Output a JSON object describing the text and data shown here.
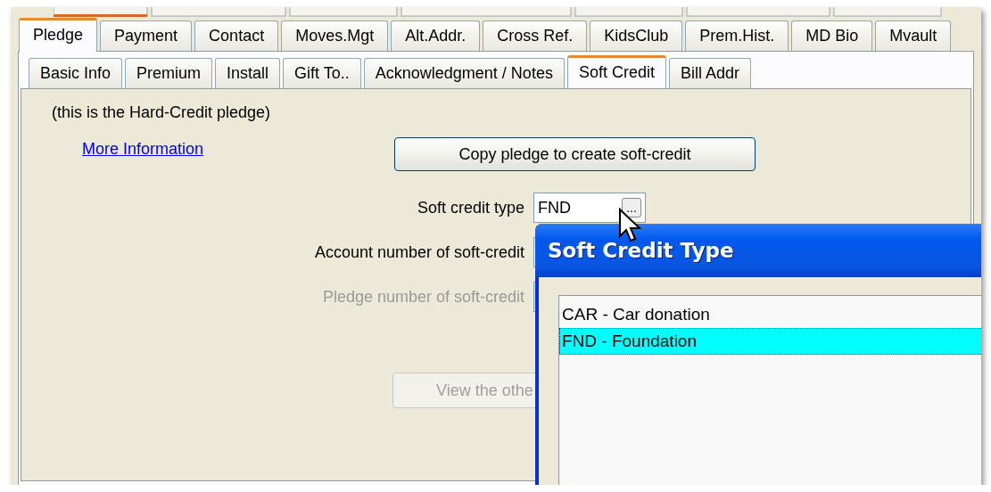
{
  "main_tabs": [
    {
      "label": "Pledge",
      "selected": true
    },
    {
      "label": "Payment",
      "selected": false
    },
    {
      "label": "Contact",
      "selected": false
    },
    {
      "label": "Moves.Mgt",
      "selected": false
    },
    {
      "label": "Alt.Addr.",
      "selected": false
    },
    {
      "label": "Cross Ref.",
      "selected": false
    },
    {
      "label": "KidsClub",
      "selected": false
    },
    {
      "label": "Prem.Hist.",
      "selected": false
    },
    {
      "label": "MD Bio",
      "selected": false
    },
    {
      "label": "Mvault",
      "selected": false
    }
  ],
  "sub_tabs": [
    {
      "label": "Basic Info",
      "selected": false
    },
    {
      "label": "Premium",
      "selected": false
    },
    {
      "label": "Install",
      "selected": false
    },
    {
      "label": "Gift To..",
      "selected": false
    },
    {
      "label": "Acknowledgment / Notes",
      "selected": false
    },
    {
      "label": "Soft Credit",
      "selected": true
    },
    {
      "label": "Bill Addr",
      "selected": false
    }
  ],
  "hard_credit_note": "(this is the Hard-Credit pledge)",
  "more_info_link": "More Information",
  "copy_button": "Copy pledge to create soft-credit",
  "fields": [
    {
      "kind": "lookup",
      "label": "Soft credit type",
      "value": "FND",
      "button": "...",
      "disabled": false
    },
    {
      "kind": "text",
      "label": "Account number of soft-credit",
      "disabled": false
    },
    {
      "kind": "text",
      "label": "Pledge number of soft-credit",
      "disabled": true
    }
  ],
  "view_button": {
    "label": "View the othe",
    "disabled": true
  },
  "dialog": {
    "title": "Soft Credit Type",
    "items": [
      {
        "label": "CAR - Car donation",
        "selected": false
      },
      {
        "label": "FND - Foundation",
        "selected": true
      }
    ]
  }
}
